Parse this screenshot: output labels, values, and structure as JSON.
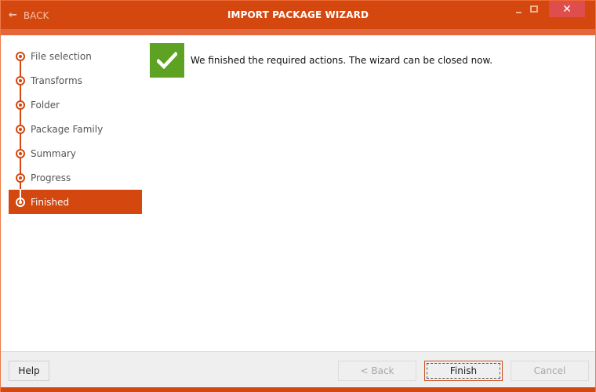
{
  "window": {
    "title": "IMPORT PACKAGE WIZARD",
    "back_label": "BACK",
    "back_icon": "arrow-left-icon",
    "controls": {
      "minimize_icon": "minimize-icon",
      "maximize_icon": "maximize-icon",
      "close_icon": "close-icon",
      "close_glyph": "✕"
    },
    "accent_color": "#d4470f",
    "close_hover_color": "#e04d4d"
  },
  "sidebar": {
    "steps": [
      {
        "label": "File selection",
        "active": false
      },
      {
        "label": "Transforms",
        "active": false
      },
      {
        "label": "Folder",
        "active": false
      },
      {
        "label": "Package Family",
        "active": false
      },
      {
        "label": "Summary",
        "active": false
      },
      {
        "label": "Progress",
        "active": false
      },
      {
        "label": "Finished",
        "active": true
      }
    ]
  },
  "main": {
    "status_icon": "checkmark-icon",
    "status_color": "#5ea223",
    "message": "We finished the required actions. The wizard can be closed now."
  },
  "footer": {
    "help_label": "Help",
    "back_label": "< Back",
    "back_enabled": false,
    "finish_label": "Finish",
    "finish_enabled": true,
    "cancel_label": "Cancel",
    "cancel_enabled": false
  }
}
